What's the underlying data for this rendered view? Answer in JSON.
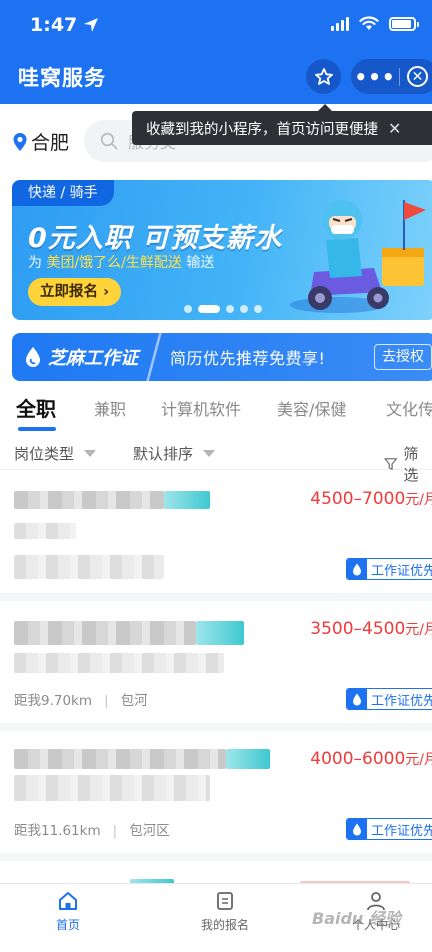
{
  "status_bar": {
    "time": "1:47"
  },
  "header": {
    "title": "哇窝服务"
  },
  "tooltip": {
    "text": "收藏到我的小程序，首页访问更便捷"
  },
  "location": {
    "city": "合肥"
  },
  "search": {
    "placeholder": "服务类"
  },
  "banner": {
    "tag": "快递 / 骑手",
    "headline": "0元入职 可预支薪水",
    "sub_prefix": "为 ",
    "sub_highlight": "美团/饿了么/生鲜配送",
    "sub_suffix": " 输送",
    "cta": "立即报名"
  },
  "zhima": {
    "title": "芝麻工作证",
    "slogan": "简历优先推荐免费享!",
    "auth_button": "去授权"
  },
  "tabs": [
    "全职",
    "兼职",
    "计算机软件",
    "美容/保健",
    "文化传"
  ],
  "filters": {
    "type": "岗位类型",
    "sort": "默认排序",
    "filter": "筛选"
  },
  "jobs": [
    {
      "salary": "4500–7000",
      "unit": "元/月",
      "distance": "",
      "area": "",
      "badge": "工作证优先"
    },
    {
      "salary": "3500–4500",
      "unit": "元/月",
      "distance": "距我9.70km",
      "area": "包河",
      "badge": "工作证优先"
    },
    {
      "salary": "4000–6000",
      "unit": "元/月",
      "distance": "距我11.61km",
      "area": "包河区",
      "badge": "工作证优先"
    }
  ],
  "bottom_nav": {
    "home": "首页",
    "my_signup": "我的报名",
    "profile": "个人中心"
  },
  "watermark": "Baidu 经验",
  "colors": {
    "primary": "#1d72f2",
    "salary": "#ef3b3b",
    "cta": "#ffd33a"
  }
}
